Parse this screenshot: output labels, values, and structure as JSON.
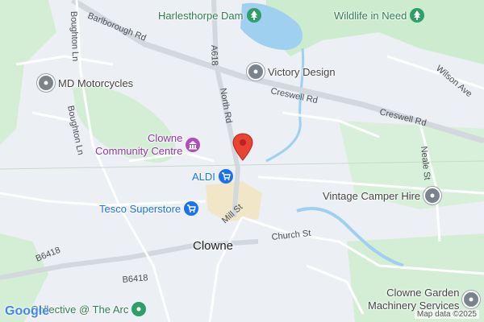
{
  "pois": [
    {
      "id": "harlesthorpe",
      "label": "Harlesthorpe Dam",
      "icon": "park-tree-icon",
      "color": "#2f7d52"
    },
    {
      "id": "wildlife",
      "label": "Wildlife in Need",
      "icon": "park-tree-icon",
      "color": "#2f7d52"
    },
    {
      "id": "victory",
      "label": "Victory Design",
      "icon": "place-icon",
      "color": "#444444"
    },
    {
      "id": "motorcycles",
      "label": "MD Motorcycles",
      "icon": "place-icon",
      "color": "#444444"
    },
    {
      "id": "community_line1",
      "label": "Clowne",
      "icon": "landmark-icon",
      "color": "#9334a6"
    },
    {
      "id": "community_line2",
      "label": "Community Centre",
      "icon": "landmark-icon",
      "color": "#9334a6"
    },
    {
      "id": "aldi",
      "label": "ALDI",
      "icon": "shopping-cart-icon",
      "color": "#1a73e8"
    },
    {
      "id": "tesco",
      "label": "Tesco Superstore",
      "icon": "shopping-cart-icon",
      "color": "#1a73e8"
    },
    {
      "id": "vintage",
      "label": "Vintage Camper Hire",
      "icon": "place-icon",
      "color": "#444444"
    },
    {
      "id": "garden_line1",
      "label": "Clowne Garden",
      "icon": "place-icon",
      "color": "#444444"
    },
    {
      "id": "garden_line2",
      "label": "Machinery Services",
      "icon": "place-icon",
      "color": "#444444"
    },
    {
      "id": "arc",
      "label": "Collective @ The Arc",
      "icon": "place-icon",
      "color": "#2f7d52"
    }
  ],
  "roads": {
    "barlborough": "Barlborough Rd",
    "creswell1": "Creswell Rd",
    "creswell2": "Creswell Rd",
    "boughton1": "Boughton Ln",
    "boughton2": "Boughton Ln",
    "a618": "A618",
    "north": "North Rd",
    "mill": "Mill St",
    "church": "Church St",
    "b6418a": "B6418",
    "b6418b": "B6418",
    "wilson": "Wilson Ave",
    "neale": "Neale St"
  },
  "town": "Clowne",
  "logo": "Google",
  "attribution": "Map data ©2025",
  "colors": {
    "water": "#9fd0f0",
    "park": "#cdeccf",
    "road": "#ffffff",
    "major_road": "#d6dbe2",
    "marker": "#ea4335"
  }
}
